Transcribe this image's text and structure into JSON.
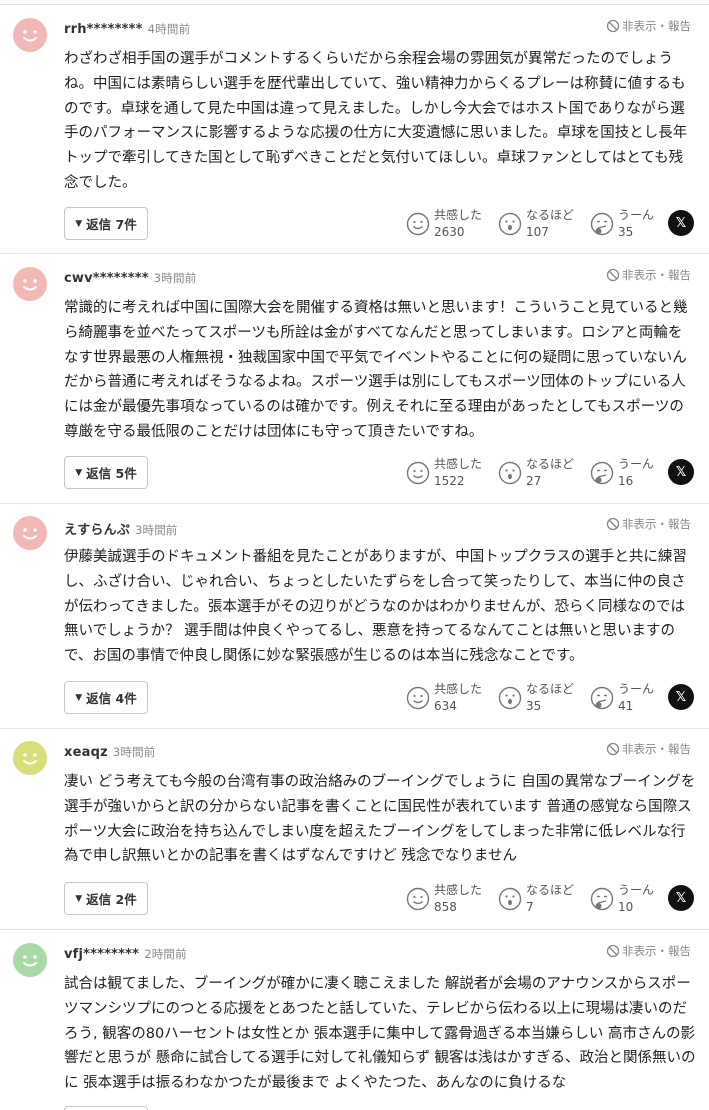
{
  "labels": {
    "hide_report": "非表示・報告",
    "react_agree": "共感した",
    "react_insight": "なるほど",
    "react_hmm": "うーん",
    "x_share": "𝕏"
  },
  "colors": {
    "avatar_pink": "#f2b8b6",
    "avatar_yellow": "#d7df7a",
    "avatar_green": "#a9d9a6"
  },
  "comments": [
    {
      "user": "rrh********",
      "time": "4時間前",
      "avatar": "pink-smiley-avatar",
      "text": "わざわざ相手国の選手がコメントするくらいだから余程会場の雰囲気が異常だったのでしょうね。中国には素晴らしい選手を歴代輩出していて、強い精神力からくるプレーは称賛に値するものです。卓球を通して見た中国は違って見えました。しかし今大会ではホスト国でありながら選手のパフォーマンスに影響するような応援の仕方に大変遺憾に思いました。卓球を国技とし長年トップで牽引してきた国として恥ずべきことだと気付いてほしい。卓球ファンとしてはとても残念でした。",
      "reply": "返信 7件",
      "agree": "2630",
      "insight": "107",
      "hmm": "35"
    },
    {
      "user": "cwv********",
      "time": "3時間前",
      "avatar": "pink-smiley-avatar",
      "text": "常識的に考えれば中国に国際大会を開催する資格は無いと思います！こういうこと見ていると幾ら綺麗事を並べたってスポーツも所詮は金がすべてなんだと思ってしまいます。ロシアと両輪をなす世界最悪の人権無視・独裁国家中国で平気でイベントやることに何の疑問に思っていないんだから普通に考えればそうなるよね。スポーツ選手は別にしてもスポーツ団体のトップにいる人には金が最優先事項なっているのは確かです。例えそれに至る理由があったとしてもスポーツの尊厳を守る最低限のことだけは団体にも守って頂きたいですね。",
      "reply": "返信 5件",
      "agree": "1522",
      "insight": "27",
      "hmm": "16"
    },
    {
      "user": "えすらんぷ",
      "time": "3時間前",
      "avatar": "pink-smiley-avatar",
      "text": "伊藤美誠選手のドキュメント番組を見たことがありますが、中国トップクラスの選手と共に練習し、ふざけ合い、じゃれ合い、ちょっとしたいたずらをし合って笑ったりして、本当に仲の良さが伝わってきました。張本選手がその辺りがどうなのかはわかりませんが、恐らく同様なのでは無いでしょうか？ 選手間は仲良くやってるし、悪意を持ってるなんてことは無いと思いますので、お国の事情で仲良し関係に妙な緊張感が生じるのは本当に残念なことです。",
      "reply": "返信 4件",
      "agree": "634",
      "insight": "35",
      "hmm": "41"
    },
    {
      "user": "xeaqz",
      "time": "3時間前",
      "avatar": "yellow-smiley-avatar",
      "text": "凄い どう考えても今般の台湾有事の政治絡みのブーイングでしょうに 自国の異常なブーイングを選手が強いからと訳の分からない記事を書くことに国民性が表れています 普通の感覚なら国際スポーツ大会に政治を持ち込んでしまい度を超えたブーイングをしてしまった非常に低レベルな行為で申し訳無いとかの記事を書くはずなんですけど 残念でなりません",
      "reply": "返信 2件",
      "agree": "858",
      "insight": "7",
      "hmm": "10"
    },
    {
      "user": "vfj********",
      "time": "2時間前",
      "avatar": "green-smiley-avatar",
      "text": "試合は観てました、ブーイングが確かに凄く聴こえました 解説者が会場のアナウンスからスポーツマンシツプにのつとる応援をとあつたと話していた、テレビから伝わる以上に現場は凄いのだろう, 観客の80ハーセントは女性とか 張本選手に集中して露骨過ぎる本当嫌らしい 高市さんの影響だと思うが 懸命に試合してる選手に対して礼儀知らず 観客は浅はかすぎる、政治と関係無いのに 張本選手は振るわなかつたが最後まで よくやたつた、あんなのに負けるな"
    }
  ]
}
